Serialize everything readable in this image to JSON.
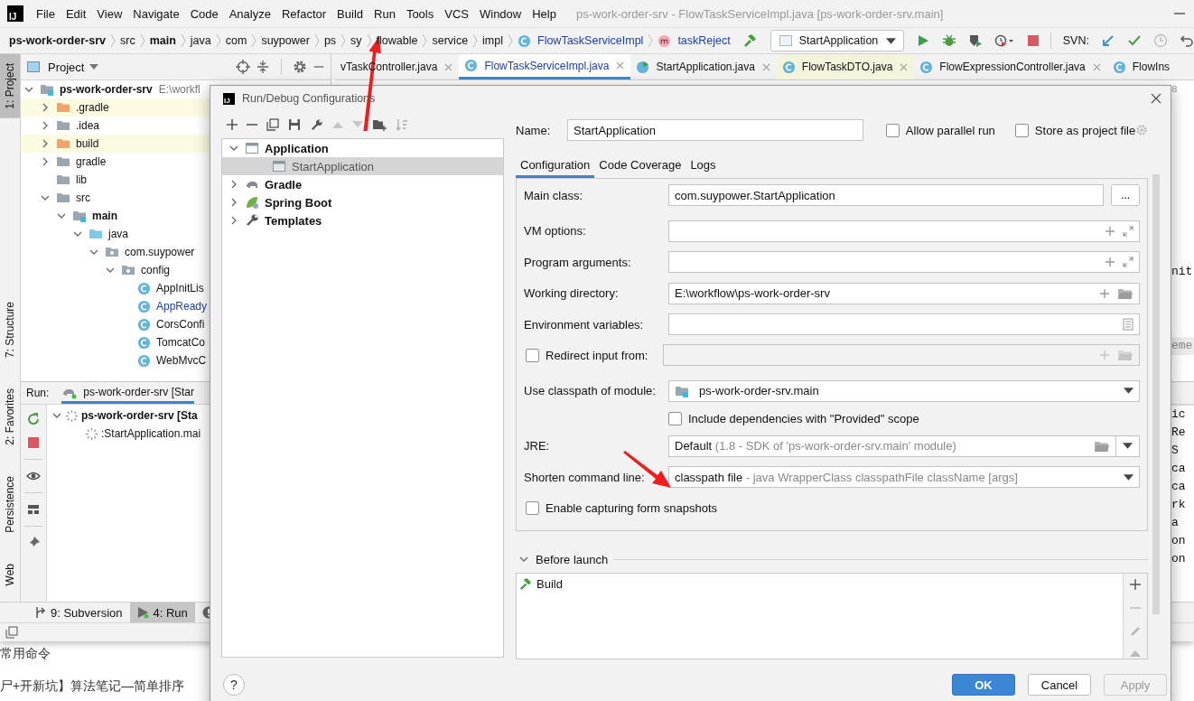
{
  "window": {
    "logo": "IJ",
    "title": "ps-work-order-srv - FlowTaskServiceImpl.java [ps-work-order-srv.main]"
  },
  "menu": [
    "File",
    "Edit",
    "View",
    "Navigate",
    "Code",
    "Analyze",
    "Refactor",
    "Build",
    "Run",
    "Tools",
    "VCS",
    "Window",
    "Help"
  ],
  "breadcrumb": [
    {
      "label": "ps-work-order-srv",
      "kind": "bold"
    },
    {
      "label": "src",
      "kind": "plain"
    },
    {
      "label": "main",
      "kind": "bold"
    },
    {
      "label": "java",
      "kind": "plain"
    },
    {
      "label": "com",
      "kind": "plain"
    },
    {
      "label": "suypower",
      "kind": "plain"
    },
    {
      "label": "ps",
      "kind": "plain"
    },
    {
      "label": "sy",
      "kind": "plain"
    },
    {
      "label": "flowable",
      "kind": "plain"
    },
    {
      "label": "service",
      "kind": "plain"
    },
    {
      "label": "impl",
      "kind": "plain"
    },
    {
      "label": "FlowTaskServiceImpl",
      "kind": "class"
    },
    {
      "label": "taskReject",
      "kind": "method"
    }
  ],
  "toolbar": {
    "run_config": "StartApplication",
    "svn_label": "SVN:"
  },
  "tool_windows_left": [
    {
      "label": "1: Project",
      "selected": true
    },
    {
      "label": "7: Structure",
      "selected": false
    },
    {
      "label": "2: Favorites",
      "selected": false
    },
    {
      "label": "Persistence",
      "selected": false
    },
    {
      "label": "Web",
      "selected": false
    }
  ],
  "project": {
    "title": "Project",
    "tree": [
      {
        "label": "ps-work-order-srv",
        "hint": "E:\\workfl",
        "kind": "module",
        "expanded": true,
        "children": [
          {
            "label": ".gradle",
            "kind": "excluded",
            "expanded": false,
            "highlighted": true
          },
          {
            "label": ".idea",
            "kind": "folder",
            "expanded": false,
            "highlighted": false
          },
          {
            "label": "build",
            "kind": "excluded",
            "expanded": false,
            "highlighted": true
          },
          {
            "label": "gradle",
            "kind": "folder",
            "expanded": false,
            "highlighted": false
          },
          {
            "label": "lib",
            "kind": "folder",
            "highlighted": false
          },
          {
            "label": "src",
            "kind": "folder",
            "expanded": true,
            "highlighted": false,
            "children": [
              {
                "label": "main",
                "kind": "module",
                "expanded": true,
                "children": [
                  {
                    "label": "java",
                    "kind": "source",
                    "expanded": true,
                    "children": [
                      {
                        "label": "com.suypower",
                        "kind": "package",
                        "expanded": true,
                        "children": [
                          {
                            "label": "config",
                            "kind": "package",
                            "expanded": true,
                            "children": [
                              {
                                "label": "AppInitLis",
                                "kind": "class",
                                "modified": false
                              },
                              {
                                "label": "AppReady",
                                "kind": "class",
                                "modified": true
                              },
                              {
                                "label": "CorsConfi",
                                "kind": "class",
                                "modified": false
                              },
                              {
                                "label": "TomcatCo",
                                "kind": "class",
                                "modified": false
                              },
                              {
                                "label": "WebMvcC",
                                "kind": "class",
                                "modified": false
                              }
                            ]
                          }
                        ]
                      }
                    ]
                  }
                ]
              }
            ]
          }
        ]
      }
    ]
  },
  "editor_tabs": [
    {
      "label": "vTaskController.java",
      "kind": "cut",
      "selected": false,
      "highlighted": false
    },
    {
      "label": "FlowTaskServiceImpl.java",
      "kind": "class",
      "selected": true,
      "highlighted": false
    },
    {
      "label": "StartApplication.java",
      "kind": "app",
      "selected": false,
      "highlighted": false
    },
    {
      "label": "FlowTaskDTO.java",
      "kind": "class",
      "selected": false,
      "highlighted": true
    },
    {
      "label": "FlowExpressionController.java",
      "kind": "class",
      "selected": false,
      "highlighted": false
    },
    {
      "label": "FlowIns",
      "kind": "last",
      "selected": false,
      "highlighted": false
    }
  ],
  "editor_lines": [
    "8",
    "nit",
    "eme"
  ],
  "run": {
    "label": "Run:",
    "tab": "ps-work-order-srv [Star",
    "tree": [
      {
        "label": "ps-work-order-srv [Sta",
        "expanded": true,
        "children": [
          {
            "label": ":StartApplication.mai"
          }
        ]
      }
    ],
    "console_lines": [
      "ic",
      "Re",
      "S",
      "ca",
      "ca",
      "rk",
      "a",
      "on",
      "on"
    ]
  },
  "bottom_tabs": [
    {
      "label": "9: Subversion",
      "kind": "vcs",
      "selected": false
    },
    {
      "label": "4: Run",
      "kind": "run",
      "selected": true
    },
    {
      "kind": "problems",
      "selected": false
    }
  ],
  "page_behind": [
    "常用命令",
    "尸+开新坑】算法笔记—简单排序"
  ],
  "dialog": {
    "icon_text": "IJ",
    "title": "Run/Debug Configurations",
    "tree": [
      {
        "label": "Application",
        "kind": "application",
        "expanded": true,
        "selected": false,
        "children": [
          {
            "label": "StartApplication",
            "kind": "config",
            "selected": true
          }
        ]
      },
      {
        "label": "Gradle",
        "kind": "gradle",
        "expanded": false,
        "selected": false
      },
      {
        "label": "Spring Boot",
        "kind": "spring",
        "expanded": false,
        "selected": false
      },
      {
        "label": "Templates",
        "kind": "templates",
        "expanded": false,
        "selected": false
      }
    ],
    "name": {
      "label": "Name:",
      "value": "StartApplication"
    },
    "options": [
      {
        "label": "Allow parallel run",
        "checked": false
      },
      {
        "label": "Store as project file",
        "checked": false
      }
    ],
    "tabs": [
      {
        "label": "Configuration",
        "selected": true
      },
      {
        "label": "Code Coverage",
        "selected": false
      },
      {
        "label": "Logs",
        "selected": false
      }
    ],
    "fields": [
      {
        "kind": "class",
        "label": "Main class:",
        "value": "com.suypower.StartApplication",
        "button": "..."
      },
      {
        "kind": "expand",
        "label": "VM options:"
      },
      {
        "kind": "expand",
        "label": "Program arguments:"
      },
      {
        "kind": "path",
        "label": "Working directory:",
        "value": "E:\\workflow\\ps-work-order-srv"
      },
      {
        "kind": "env",
        "label": "Environment variables:"
      },
      {
        "kind": "redirect",
        "label": "Redirect input from:",
        "checked": false
      },
      {
        "kind": "module",
        "label": "Use classpath of module:",
        "value": "ps-work-order-srv.main"
      },
      {
        "kind": "sub_checkbox",
        "label": "Include dependencies with \"Provided\" scope",
        "checked": false
      },
      {
        "kind": "jre",
        "label": "JRE:",
        "value": "Default",
        "hint": "(1.8 - SDK of 'ps-work-order-srv.main' module)"
      },
      {
        "kind": "combo",
        "label": "Shorten command line:",
        "value": "classpath file",
        "hint": "- java WrapperClass classpathFile className [args]"
      },
      {
        "kind": "checkbox",
        "label": "Enable capturing form snapshots",
        "checked": false
      }
    ],
    "before_launch": {
      "label": "Before launch",
      "expanded": true,
      "tasks": [
        {
          "label": "Build"
        }
      ]
    },
    "help": "?",
    "buttons": [
      {
        "label": "OK",
        "kind": "primary",
        "disabled": false
      },
      {
        "label": "Cancel",
        "kind": "normal",
        "disabled": false
      },
      {
        "label": "Apply",
        "kind": "normal",
        "disabled": true
      }
    ]
  }
}
